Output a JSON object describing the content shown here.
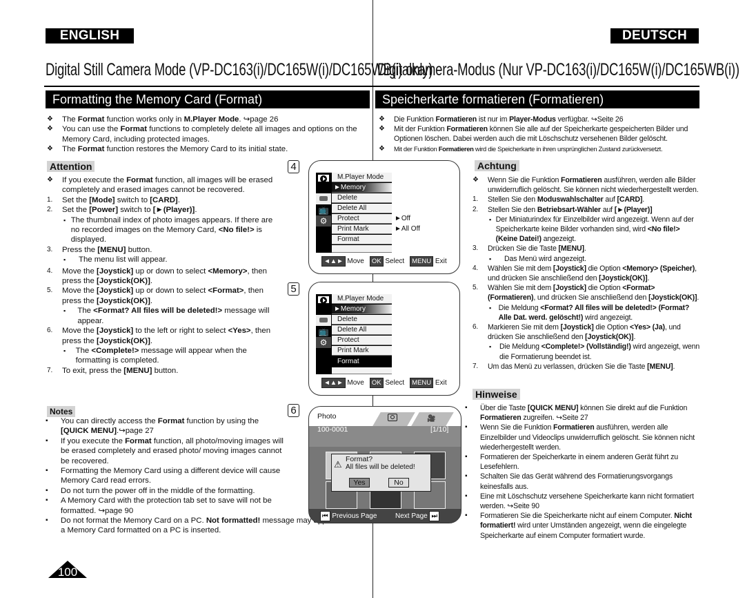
{
  "header": {
    "lang_en": "ENGLISH",
    "lang_de": "DEUTSCH",
    "mode_title_en": "Digital Still Camera Mode (VP-DC163(i)/DC165W(i)/DC165WB(i) only)",
    "mode_title_de": "Digitalkamera-Modus (Nur VP-DC163(i)/DC165W(i)/DC165WB(i))",
    "section_en": "Formatting the Memory Card (Format)",
    "section_de": "Speicherkarte formatieren (Formatieren)"
  },
  "en": {
    "intro": [
      {
        "pre": "The ",
        "b1": "Format",
        "mid": " function works only in ",
        "b2": "M.Player Mode",
        "post": ". ↪page 26"
      },
      {
        "pre": "You can use the ",
        "b1": "Format",
        "post": " functions to completely delete all images and options on the Memory Card, including protected images."
      },
      {
        "pre": "The ",
        "b1": "Format",
        "post": " function restores the Memory Card to its initial state."
      }
    ],
    "attention_label": "Attention",
    "attention_text": {
      "pre": "If you execute the ",
      "b1": "Format",
      "post": " function, all images will be erased completely and erased images cannot be recovered."
    },
    "steps": [
      {
        "num": "1.",
        "pre": "Set the ",
        "b1": "[Mode]",
        "mid": " switch to ",
        "b2": "[CARD]",
        "post": "."
      },
      {
        "num": "2.",
        "pre": "Set the ",
        "b1": "[Power]",
        "mid": " switch to ",
        "b2": "[►(Player)]",
        "post": ".",
        "sub": {
          "pre": "The thumbnail index of photo images appears. If there are no recorded images on the Memory Card, ",
          "b1": "<No file!>",
          "post": " is displayed."
        }
      },
      {
        "num": "3.",
        "pre": "Press the ",
        "b1": "[MENU]",
        "post": " button.",
        "sub": {
          "pre": "The menu list will appear."
        }
      },
      {
        "num": "4.",
        "pre": "Move the ",
        "b1": "[Joystick]",
        "mid": " up or down to select ",
        "b2": "<Memory>",
        "mid2": ", then press the ",
        "b3": "[Joystick(OK)]",
        "post": "."
      },
      {
        "num": "5.",
        "pre": "Move the ",
        "b1": "[Joystick]",
        "mid": " up or down to select ",
        "b2": "<Format>",
        "mid2": ", then press the ",
        "b3": "[Joystick(OK)]",
        "post": ".",
        "sub": {
          "pre": "The ",
          "b1": "<Format? All files will be deleted!>",
          "post": " message will appear."
        }
      },
      {
        "num": "6.",
        "pre": "Move the ",
        "b1": "[Joystick]",
        "mid": " to the left or right to select ",
        "b2": "<Yes>",
        "mid2": ", then press the ",
        "b3": "[Joystick(OK)]",
        "post": ".",
        "sub": {
          "pre": "The ",
          "b1": "<Complete!>",
          "post": " message will appear when the formatting is completed."
        }
      },
      {
        "num": "7.",
        "pre": "To exit, press the ",
        "b1": "[MENU]",
        "post": " button."
      }
    ],
    "notes_label": "Notes",
    "notes": [
      {
        "pre": "You can directly access the ",
        "b1": "Format",
        "mid": " function by using the ",
        "b2": "[QUICK MENU]",
        "post": ".↪page 27"
      },
      {
        "pre": "If you execute the ",
        "b1": "Format",
        "post": " function, all photo/moving images will be erased completely and erased photo/ moving images cannot be recovered."
      },
      {
        "pre": "Formatting the Memory Card using a different device will cause Memory Card read errors."
      },
      {
        "pre": "Do not turn the power off in the middle of the formatting."
      },
      {
        "pre": "A Memory Card with the protection tab set to save will not be formatted. ↪page 90"
      },
      {
        "pre": "Do not format the Memory Card on a PC. ",
        "b1": "Not formatted!",
        "post": " message may appear if a Memory Card formatted on a PC is inserted."
      }
    ],
    "page_number": "100"
  },
  "screens": {
    "step_labels": [
      "4",
      "5",
      "6"
    ],
    "menu_title": "M.Player Mode",
    "menu_memory": "►Memory",
    "menu_items": [
      "Delete",
      "Delete All",
      "Protect",
      "Print Mark",
      "Format"
    ],
    "protect_value": "►Off",
    "printmark_value": "►All Off",
    "hint_move": "Move",
    "hint_ok_key": "OK",
    "hint_select": "Select",
    "hint_menu_key": "MENU",
    "hint_exit": "Exit",
    "photo_label": "Photo",
    "file_id": "100-0001",
    "file_count": "[1/10]",
    "dialog_line1": "Format?",
    "dialog_line2": "All files will be deleted!",
    "dialog_yes": "Yes",
    "dialog_no": "No",
    "prev_page": "Previous Page",
    "next_page": "Next Page"
  },
  "de": {
    "intro": [
      {
        "pre": "Die Funktion ",
        "b1": "Formatieren",
        "mid": " ist nur im ",
        "b2": "Player-Modus",
        "post": " verfügbar. ↪Seite 26"
      },
      {
        "pre": "Mit der Funktion ",
        "b1": "Formatieren",
        "post": " können Sie alle auf der Speicherkarte gespeicherten Bilder und Optionen löschen. Dabei werden auch die mit Löschschutz versehenen Bilder gelöscht."
      },
      {
        "pre": "Mit der Funktion ",
        "b1": "Formatieren",
        "post": " wird die Speicherkarte in ihren ursprünglichen Zustand zurückversetzt."
      }
    ],
    "attention_label": "Achtung",
    "attention_text": {
      "pre": "Wenn Sie die Funktion ",
      "b1": "Formatieren",
      "post": " ausführen, werden alle Bilder unwiderruflich gelöscht. Sie können nicht wiederhergestellt werden."
    },
    "steps": [
      {
        "num": "1.",
        "pre": "Stellen Sie den ",
        "b1": "Moduswahlschalter",
        "mid": " auf ",
        "b2": "[CARD]",
        "post": "."
      },
      {
        "num": "2.",
        "pre": "Stellen Sie den ",
        "b1": "Betriebsart-Wähler",
        "mid": " auf ",
        "b2": "[►(Player)]",
        "post": "",
        "sub": {
          "pre": "Der Miniaturindex für Einzelbilder wird angezeigt. Wenn auf der Speicherkarte keine Bilder vorhanden sind, wird ",
          "b1": "<No file!> (Keine Datei!)",
          "post": " angezeigt."
        }
      },
      {
        "num": "3.",
        "pre": "Drücken Sie die Taste ",
        "b1": "[MENU]",
        "post": ".",
        "sub": {
          "pre": "Das Menü wird angezeigt."
        }
      },
      {
        "num": "4.",
        "pre": "Wählen Sie mit dem ",
        "b1": "[Joystick]",
        "mid": " die Option ",
        "b2": "<Memory> (Speicher)",
        "mid2": ", und drücken Sie anschließend den ",
        "b3": "[Joystick(OK)]",
        "post": "."
      },
      {
        "num": "5.",
        "pre": "Wählen Sie mit dem ",
        "b1": "[Joystick]",
        "mid": " die Option ",
        "b2": "<Format> (Formatieren)",
        "mid2": ", und drücken Sie anschließend den ",
        "b3": "[Joystick(OK)]",
        "post": ".",
        "sub": {
          "pre": "Die Meldung ",
          "b1": "<Format? All files will be deleted!> (Format? Alle Dat. werd. gelöscht!)",
          "post": " wird angezeigt."
        }
      },
      {
        "num": "6.",
        "pre": "Markieren Sie mit dem ",
        "b1": "[Joystick]",
        "mid": " die Option ",
        "b2": "<Yes> (Ja)",
        "mid2": ", und drücken Sie anschließend den ",
        "b3": "[Joystick(OK)]",
        "post": ".",
        "sub": {
          "pre": "Die Meldung ",
          "b1": "<Complete!> (Vollständig!)",
          "post": " wird angezeigt, wenn die Formatierung beendet ist."
        }
      },
      {
        "num": "7.",
        "pre": "Um das Menü zu verlassen, drücken Sie die Taste ",
        "b1": "[MENU]",
        "post": "."
      }
    ],
    "notes_label": "Hinweise",
    "notes": [
      {
        "pre": "Über die Taste ",
        "b1": "[QUICK MENU]",
        "mid": " können Sie direkt auf die Funktion ",
        "b2": "Formatieren",
        "post": " zugreifen. ↪Seite 27"
      },
      {
        "pre": "Wenn Sie die Funktion ",
        "b1": "Formatieren",
        "post": " ausführen, werden alle Einzelbilder und Videoclips unwiderruflich gelöscht. Sie können nicht wiederhergestellt werden."
      },
      {
        "pre": "Formatieren der Speicherkarte in einem anderen Gerät führt zu Lesefehlern."
      },
      {
        "pre": "Schalten Sie das Gerät während des Formatierungsvorgangs keinesfalls aus."
      },
      {
        "pre": "Eine mit Löschschutz versehene Speicherkarte kann nicht formatiert werden. ↪Seite 90"
      },
      {
        "pre": "Formatieren Sie die Speicherkarte nicht auf einem Computer. ",
        "b1": "Nicht formatiert!",
        "post": " wird unter Umständen angezeigt, wenn die eingelegte Speicherkarte auf einem Computer formatiert wurde."
      }
    ]
  }
}
